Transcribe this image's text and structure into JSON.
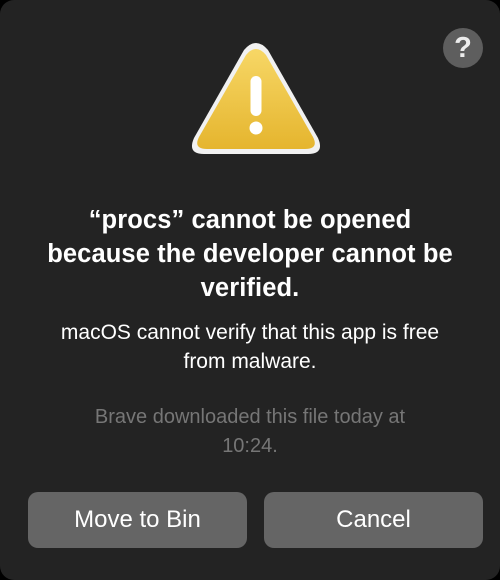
{
  "help": {
    "label": "?"
  },
  "dialog": {
    "title_line1": "“procs” cannot be opened",
    "title_line2": "because the developer cannot be",
    "title_line3": "verified.",
    "message_line1": "macOS cannot verify that this app is free",
    "message_line2": "from malware.",
    "info_line1": "Brave downloaded this file today at",
    "info_line2": "10:24."
  },
  "buttons": {
    "move_to_bin": "Move to Bin",
    "cancel": "Cancel"
  },
  "icon": {
    "name": "warning-icon",
    "color": "#f2c94c"
  },
  "colors": {
    "background": "#232323",
    "button": "#656565",
    "info_text": "#767676"
  }
}
